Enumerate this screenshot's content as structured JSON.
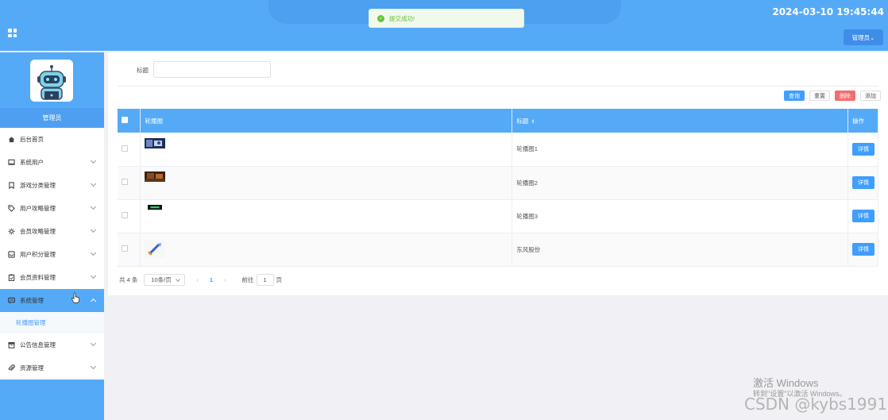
{
  "header": {
    "datetime": "2024-03-10 19:45:44",
    "admin_label": "管理员⌄"
  },
  "toast": {
    "message": "提交成功!"
  },
  "sidebar": {
    "role": "管理员",
    "menu": [
      {
        "label": "后台首页",
        "icon": "home-icon"
      },
      {
        "label": "系统用户",
        "icon": "monitor-icon"
      },
      {
        "label": "游戏分类管理",
        "icon": "bookmark-icon"
      },
      {
        "label": "用户攻略管理",
        "icon": "tag-icon"
      },
      {
        "label": "会员攻略管理",
        "icon": "sun-icon"
      },
      {
        "label": "用户积分管理",
        "icon": "inbox-icon"
      },
      {
        "label": "会员资料管理",
        "icon": "clipboard-icon"
      },
      {
        "label": "系统管理",
        "icon": "message-icon"
      },
      {
        "label": "公告信息管理",
        "icon": "archive-icon"
      },
      {
        "label": "资源管理",
        "icon": "paperclip-icon"
      }
    ],
    "submenu_active": "轮播图管理"
  },
  "search": {
    "label": "标题",
    "value": ""
  },
  "toolbar": {
    "query": "查询",
    "reset": "重置",
    "delete": "删除",
    "add": "添加"
  },
  "table": {
    "columns": [
      "轮播图",
      "标题",
      "操作"
    ],
    "rows": [
      {
        "title": "轮播图1",
        "action": "详情"
      },
      {
        "title": "轮播图2",
        "action": "详情"
      },
      {
        "title": "轮播图3",
        "action": "详情"
      },
      {
        "title": "东风股份",
        "action": "详情"
      }
    ]
  },
  "pagination": {
    "total": "共 4 条",
    "page_size": "10条/页",
    "current": "1",
    "goto_prefix": "前往",
    "goto_value": "1",
    "goto_suffix": "页"
  },
  "watermark": {
    "activate_title": "激活 Windows",
    "activate_sub": "转到\"设置\"以激活 Windows。",
    "csdn": "CSDN @kybs1991"
  }
}
